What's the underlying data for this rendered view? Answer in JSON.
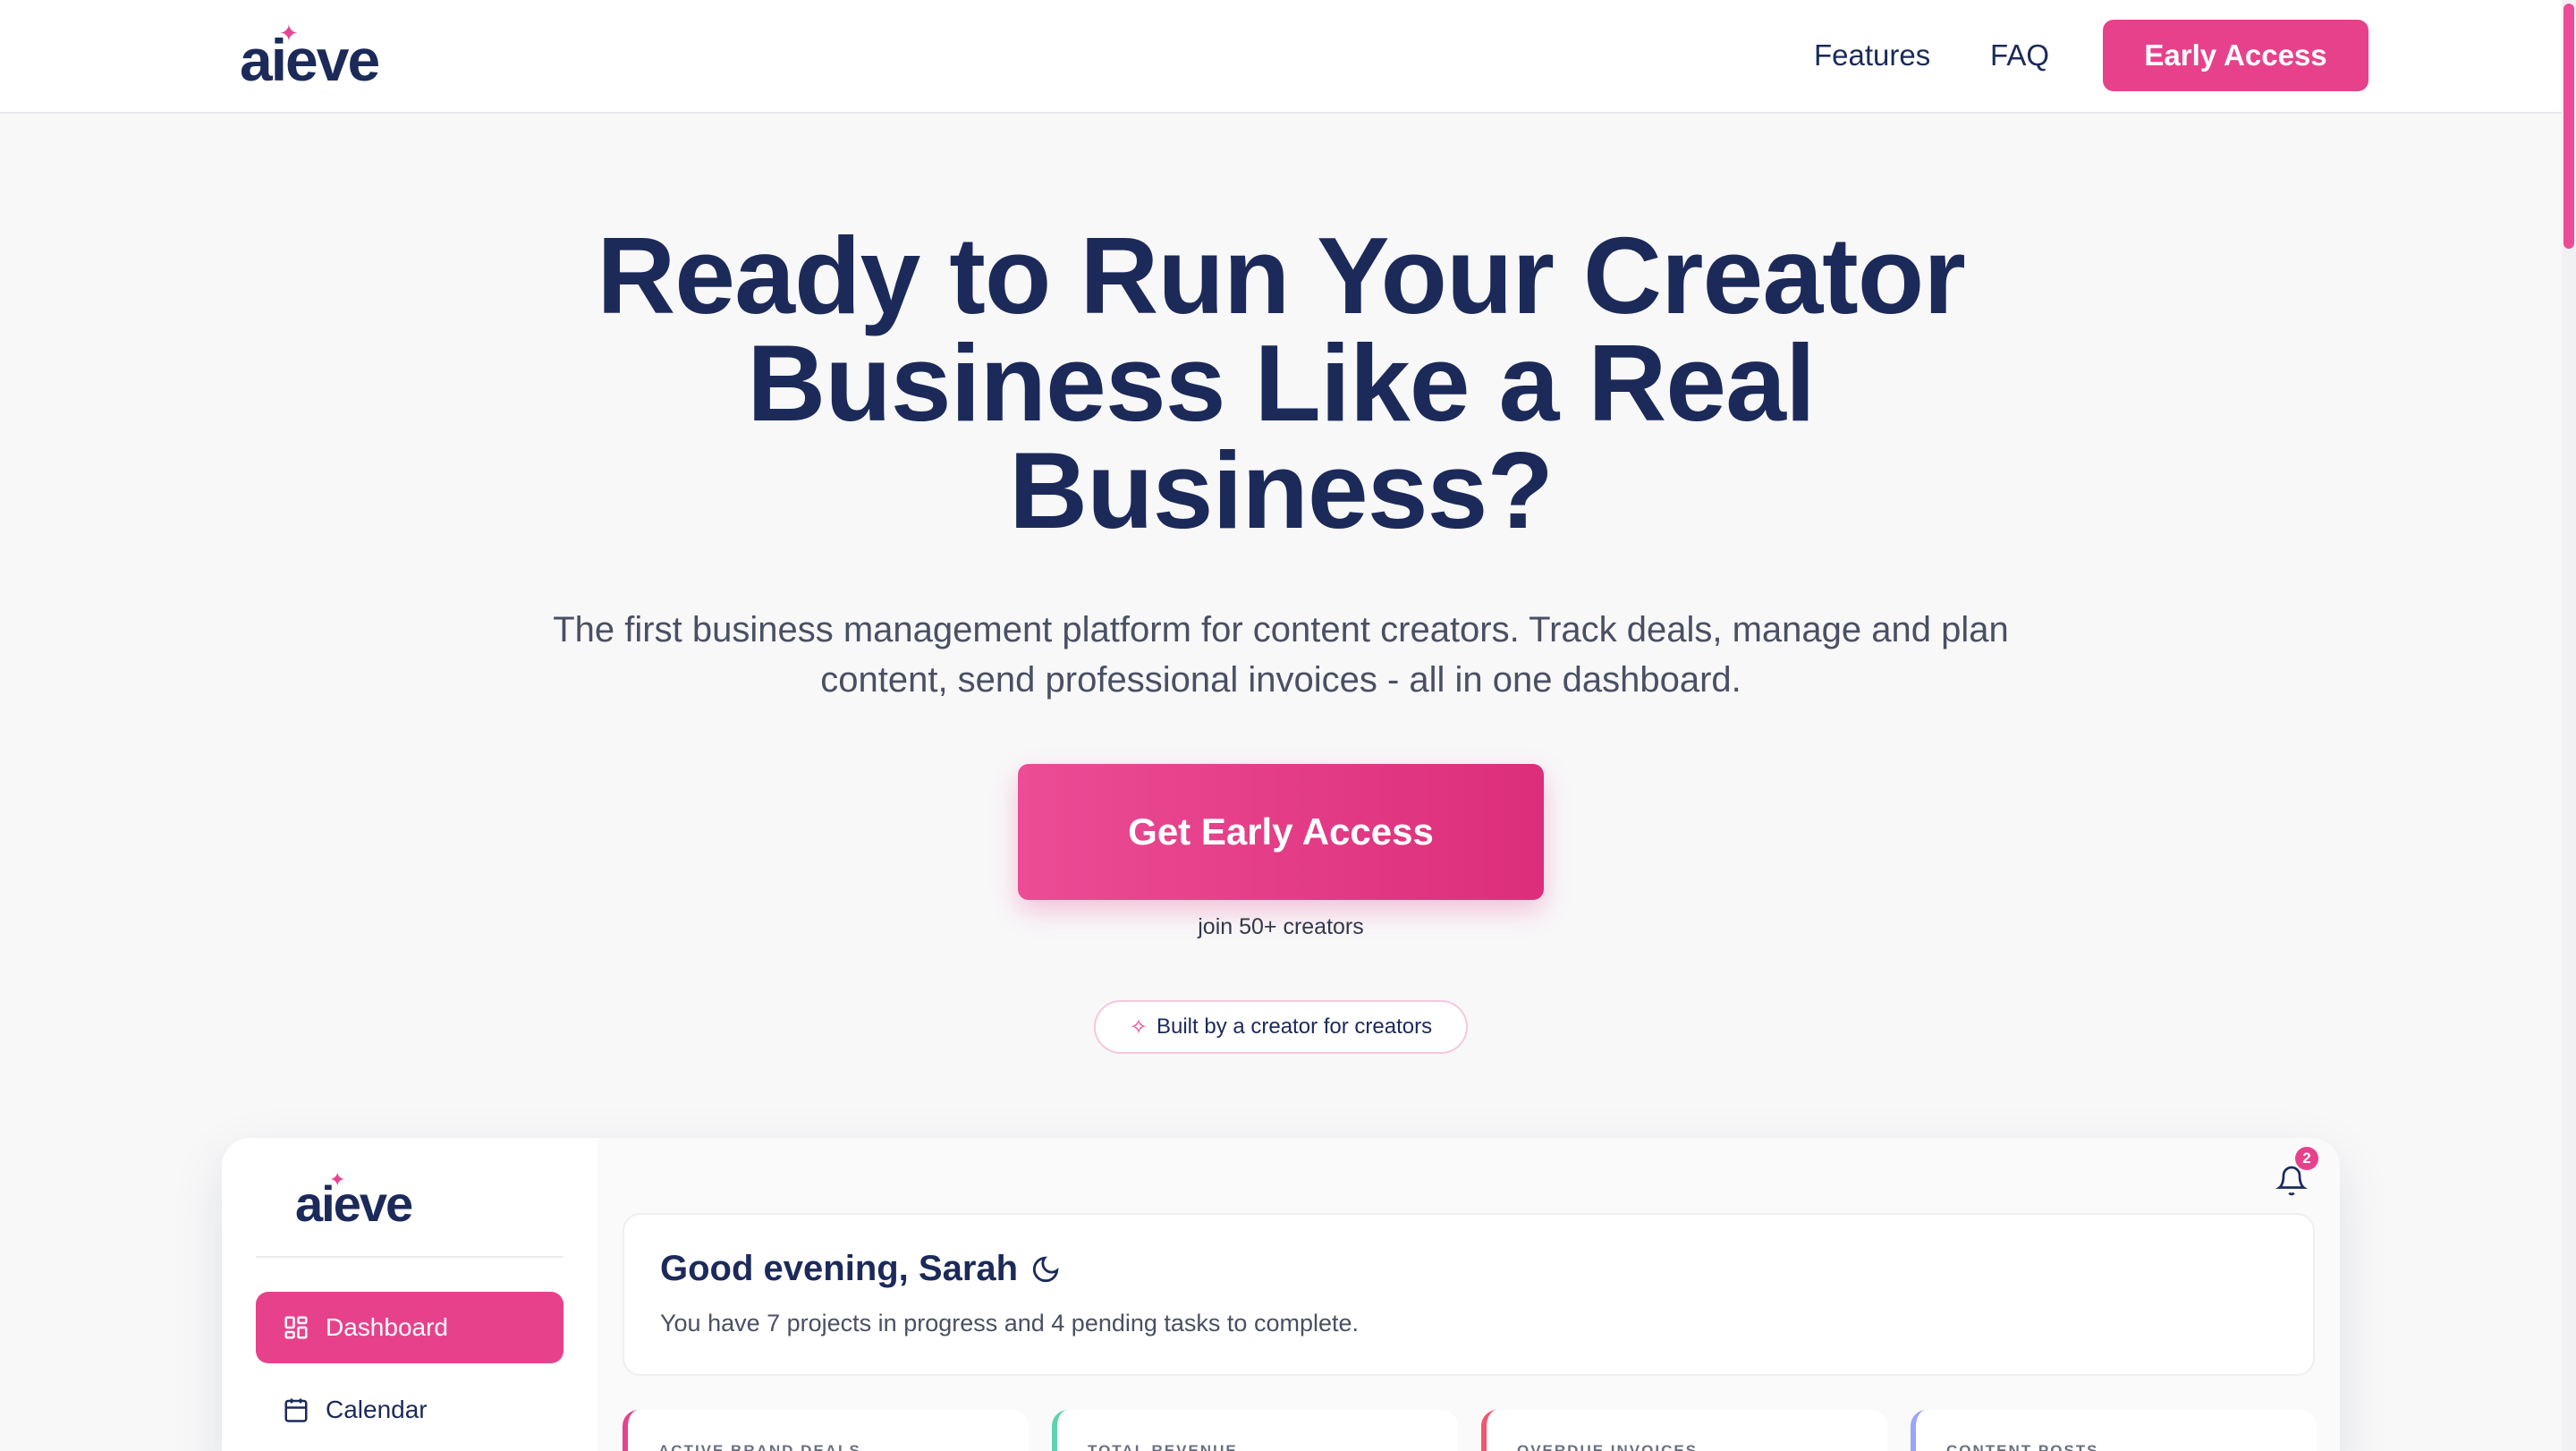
{
  "header": {
    "logo": "aieve",
    "nav": {
      "features": "Features",
      "faq": "FAQ",
      "cta": "Early Access"
    }
  },
  "hero": {
    "title_lines": [
      "Ready to Run Your Creator",
      "Business Like a Real",
      "Business?"
    ],
    "subtitle_lines": [
      "The first business management platform for content creators. Track deals, manage and plan",
      "content, send professional invoices - all in one dashboard."
    ],
    "cta": "Get Early Access",
    "cta_note": "join 50+ creators",
    "badge": "Built by a creator for creators"
  },
  "preview": {
    "logo": "aieve",
    "sidebar": [
      {
        "label": "Dashboard",
        "icon": "grid-icon",
        "active": true
      },
      {
        "label": "Calendar",
        "icon": "calendar-icon",
        "active": false
      }
    ],
    "notifications_count": "2",
    "greeting": "Good evening, Sarah",
    "greeting_sub": "You have 7 projects in progress and 4 pending tasks to complete.",
    "stats": [
      "ACTIVE BRAND DEALS",
      "TOTAL REVENUE",
      "OVERDUE INVOICES",
      "CONTENT POSTS"
    ]
  },
  "colors": {
    "accent": "#e8418c",
    "navy": "#1c2a5a",
    "teal": "#5fd3b0",
    "red": "#f0566d",
    "lavender": "#9aa6f5"
  }
}
